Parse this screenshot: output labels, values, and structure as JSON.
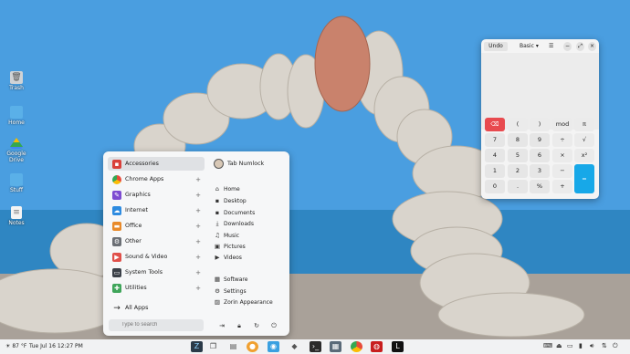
{
  "desktop": {
    "icons": [
      {
        "label": "Trash",
        "icon": "trash-icon"
      },
      {
        "label": "Home",
        "icon": "folder-icon"
      },
      {
        "label": "Google Drive",
        "icon": "google-drive-icon"
      },
      {
        "label": "Stuff",
        "icon": "folder-icon"
      },
      {
        "label": "Notes",
        "icon": "document-icon"
      }
    ]
  },
  "menu": {
    "categories": [
      {
        "label": "Accessories",
        "icon": "toolbox-icon",
        "color": "#d9403a"
      },
      {
        "label": "Chrome Apps",
        "icon": "chrome-icon",
        "color": "#e84b3a"
      },
      {
        "label": "Graphics",
        "icon": "graphics-icon",
        "color": "#7d4bd1"
      },
      {
        "label": "Internet",
        "icon": "cloud-icon",
        "color": "#2d8be0"
      },
      {
        "label": "Office",
        "icon": "briefcase-icon",
        "color": "#e88a2a"
      },
      {
        "label": "Other",
        "icon": "gear-icon",
        "color": "#6b6f75"
      },
      {
        "label": "Sound & Video",
        "icon": "media-icon",
        "color": "#e0504a"
      },
      {
        "label": "System Tools",
        "icon": "monitor-icon",
        "color": "#3b4048"
      },
      {
        "label": "Utilities",
        "icon": "utilities-icon",
        "color": "#3fa55a"
      }
    ],
    "all_apps": "All Apps",
    "user": "Tab Numlock",
    "places": [
      {
        "label": "Home",
        "icon": "home-icon"
      },
      {
        "label": "Desktop",
        "icon": "desktop-icon"
      },
      {
        "label": "Documents",
        "icon": "documents-icon"
      },
      {
        "label": "Downloads",
        "icon": "downloads-icon"
      },
      {
        "label": "Music",
        "icon": "music-icon"
      },
      {
        "label": "Pictures",
        "icon": "pictures-icon"
      },
      {
        "label": "Videos",
        "icon": "videos-icon"
      }
    ],
    "system": [
      {
        "label": "Software",
        "icon": "software-icon"
      },
      {
        "label": "Settings",
        "icon": "settings-icon"
      },
      {
        "label": "Zorin Appearance",
        "icon": "zorin-appearance-icon"
      }
    ],
    "search_placeholder": "Type to search"
  },
  "calculator": {
    "undo": "Undo",
    "mode": "Basic",
    "keys": [
      [
        "⌫",
        "(",
        ")",
        "mod",
        "π"
      ],
      [
        "7",
        "8",
        "9",
        "÷",
        "√"
      ],
      [
        "4",
        "5",
        "6",
        "×",
        "x²"
      ],
      [
        "1",
        "2",
        "3",
        "−",
        "="
      ],
      [
        "0",
        ".",
        "%",
        "+",
        ""
      ]
    ]
  },
  "taskbar": {
    "weather": "87 °F",
    "datetime": "Tue Jul 16  12:27 PM"
  }
}
